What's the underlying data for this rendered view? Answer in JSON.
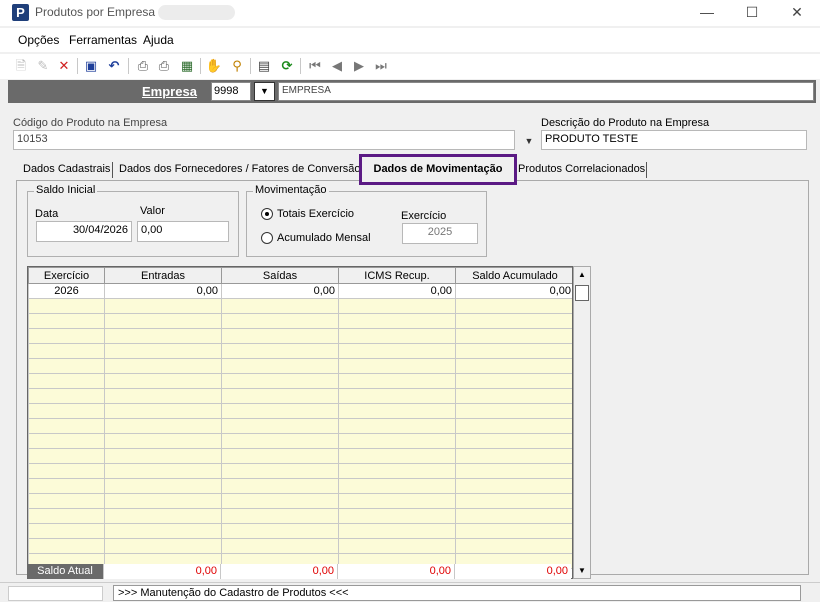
{
  "window": {
    "title": "Produtos por Empresa",
    "icon_letter": "P"
  },
  "menu": [
    "Opções",
    "Ferramentas",
    "Ajuda"
  ],
  "empresa": {
    "label": "Empresa",
    "code": "9998",
    "name": "EMPRESA"
  },
  "produto": {
    "codigo_label": "Código do Produto na Empresa",
    "codigo": "10153",
    "descricao_label": "Descrição do Produto na Empresa",
    "descricao": "PRODUTO TESTE"
  },
  "tabs": [
    "Dados Cadastrais",
    "Dados dos Fornecedores / Fatores de Conversão",
    "Dados de Movimentação",
    "Produtos Correlacionados"
  ],
  "saldo_inicial": {
    "title": "Saldo Inicial",
    "data_label": "Data",
    "data": "30/04/2026",
    "valor_label": "Valor",
    "valor": "0,00"
  },
  "movimentacao": {
    "title": "Movimentação",
    "opt1": "Totais Exercício",
    "opt2": "Acumulado Mensal",
    "selected": "Totais Exercício",
    "exercicio_label": "Exercício",
    "exercicio": "2025"
  },
  "grid": {
    "columns": [
      "Exercício",
      "Entradas",
      "Saídas",
      "ICMS Recup.",
      "Saldo Acumulado"
    ],
    "rows": [
      [
        "2026",
        "0,00",
        "0,00",
        "0,00",
        "0,00"
      ]
    ]
  },
  "totals": {
    "label": "Saldo Atual",
    "values": [
      "0,00",
      "0,00",
      "0,00",
      "0,00"
    ]
  },
  "status": {
    "text": ">>> Manutenção do Cadastro de Produtos <<<"
  },
  "colors": {
    "accent_tab_border": "#5b1a84",
    "total_text": "#e00000",
    "grid_row": "#fcfbd8",
    "header_bar": "#6a6a6a"
  }
}
